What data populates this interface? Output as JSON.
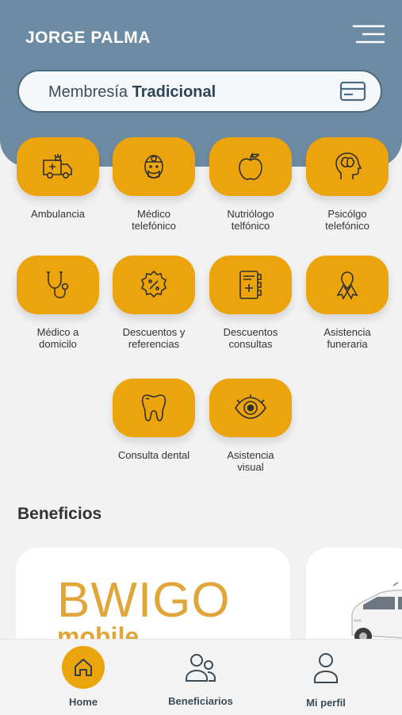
{
  "header": {
    "user_name": "JORGE PALMA",
    "menu_icon": "hamburger-menu-icon",
    "membership_prefix": "Membresía",
    "membership_type": "Tradicional",
    "card_icon": "credit-card-icon"
  },
  "services": [
    {
      "label": "Ambulancia",
      "icon": "ambulance-icon"
    },
    {
      "label": "Médico\ntelefónico",
      "icon": "doctor-icon"
    },
    {
      "label": "Nutriólogo\ntelfónico",
      "icon": "apple-icon"
    },
    {
      "label": "Psicólgo\ntelefónico",
      "icon": "brain-head-icon"
    },
    {
      "label": "Médico a\ndomicilo",
      "icon": "stethoscope-icon"
    },
    {
      "label": "Descuentos y\nreferencias",
      "icon": "discount-badge-icon"
    },
    {
      "label": "Descuentos\nconsultas",
      "icon": "medical-book-icon"
    },
    {
      "label": "Asistencia\nfuneraria",
      "icon": "ribbon-icon"
    },
    {
      "label": "Consulta dental",
      "icon": "tooth-icon"
    },
    {
      "label": "Asistencia\nvisual",
      "icon": "eye-icon"
    }
  ],
  "benefits": {
    "title": "Beneficios",
    "card1_logo": "BWIGO",
    "card1_sub": "mobile"
  },
  "nav": {
    "home": "Home",
    "beneficiaries": "Beneficiarios",
    "profile": "Mi perfil"
  },
  "colors": {
    "header_bg": "#6d8ca3",
    "accent": "#eca40d",
    "nav_text": "#3a4b58"
  }
}
